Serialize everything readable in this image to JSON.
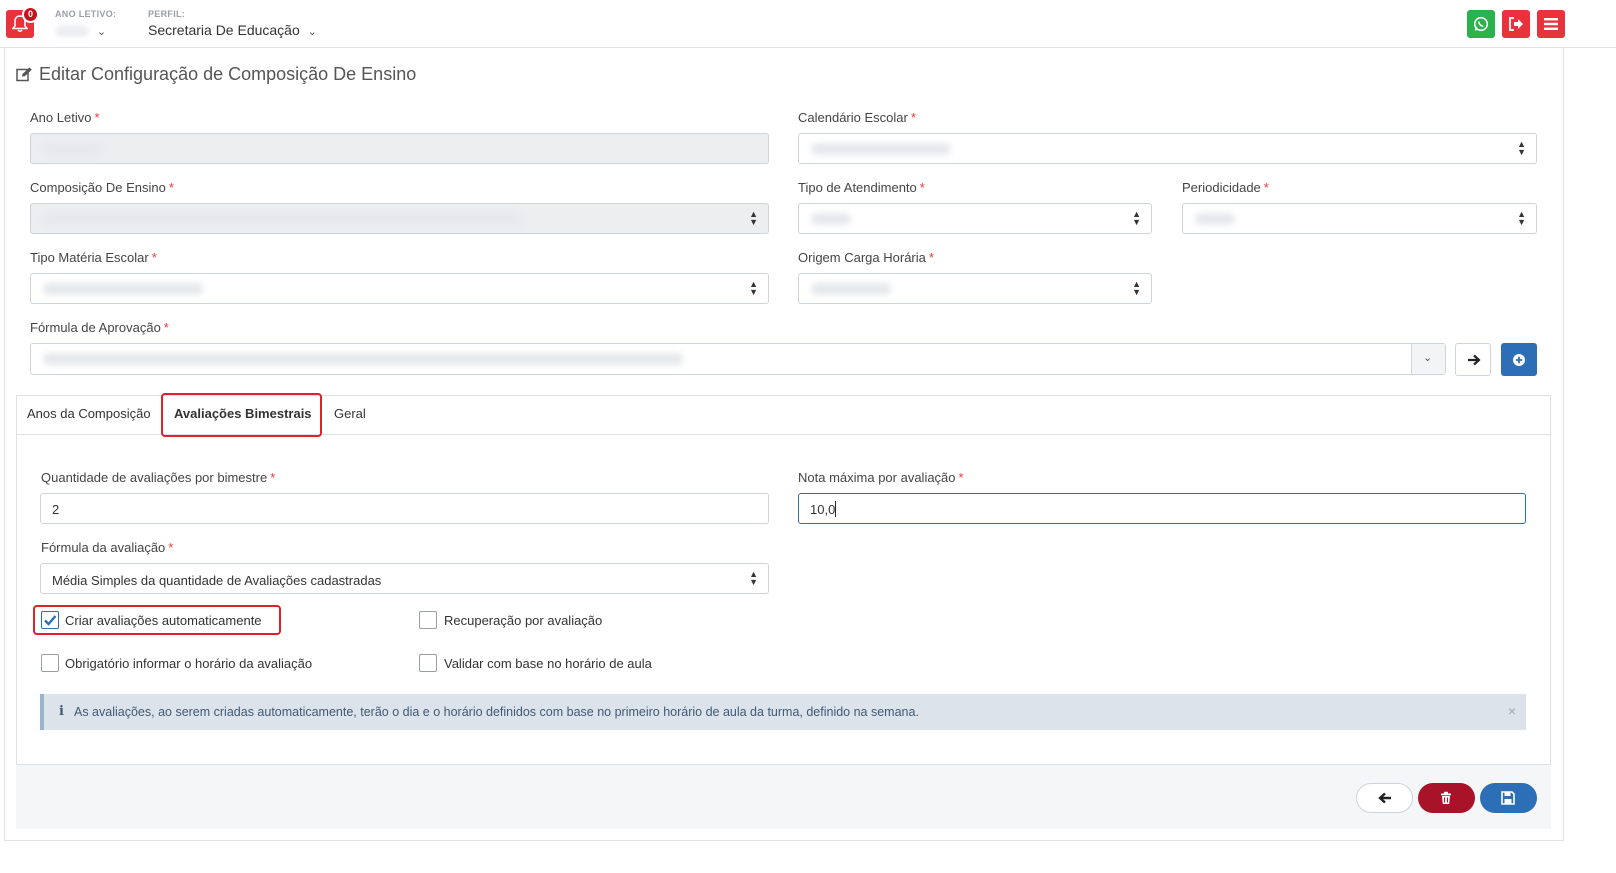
{
  "header": {
    "notification_count": "0",
    "year_label": "ANO LETIVO:",
    "profile_label": "PERFIL:",
    "profile_value": "Secretaria De Educação",
    "colors": {
      "red": "#e8323c",
      "green": "#2bb24c",
      "blue": "#2d6fb6"
    }
  },
  "page": {
    "title": "Editar Configuração de Composição De Ensino"
  },
  "form": {
    "ano_letivo": {
      "label": "Ano Letivo"
    },
    "calendario": {
      "label": "Calendário Escolar"
    },
    "composicao": {
      "label": "Composição De Ensino"
    },
    "tipo_atendimento": {
      "label": "Tipo de Atendimento"
    },
    "periodicidade": {
      "label": "Periodicidade"
    },
    "tipo_materia": {
      "label": "Tipo Matéria Escolar"
    },
    "origem_carga": {
      "label": "Origem Carga Horária"
    },
    "formula_aprovacao": {
      "label": "Fórmula de Aprovação"
    },
    "required_mark": "*"
  },
  "tabs": [
    {
      "label": "Anos da Composição"
    },
    {
      "label": "Avaliações Bimestrais"
    },
    {
      "label": "Geral"
    }
  ],
  "bimestral": {
    "quantidade": {
      "label": "Quantidade de avaliações por bimestre",
      "value": "2"
    },
    "nota_maxima": {
      "label": "Nota máxima por avaliação",
      "value": "10,0"
    },
    "formula": {
      "label": "Fórmula da avaliação",
      "value": "Média Simples da quantidade de Avaliações cadastradas"
    },
    "checkboxes": {
      "criar": {
        "label": "Criar avaliações automaticamente",
        "checked": true
      },
      "recuperacao": {
        "label": "Recuperação por avaliação",
        "checked": false
      },
      "obrigatorio": {
        "label": "Obrigatório informar o horário da avaliação",
        "checked": false
      },
      "validar": {
        "label": "Validar com base no horário de aula",
        "checked": false
      }
    },
    "alert": {
      "icon": "i",
      "text": "As avaliações, ao serem criadas automaticamente, terão o dia e o horário definidos com base no primeiro horário de aula da turma, definido na semana.",
      "close": "×"
    }
  }
}
